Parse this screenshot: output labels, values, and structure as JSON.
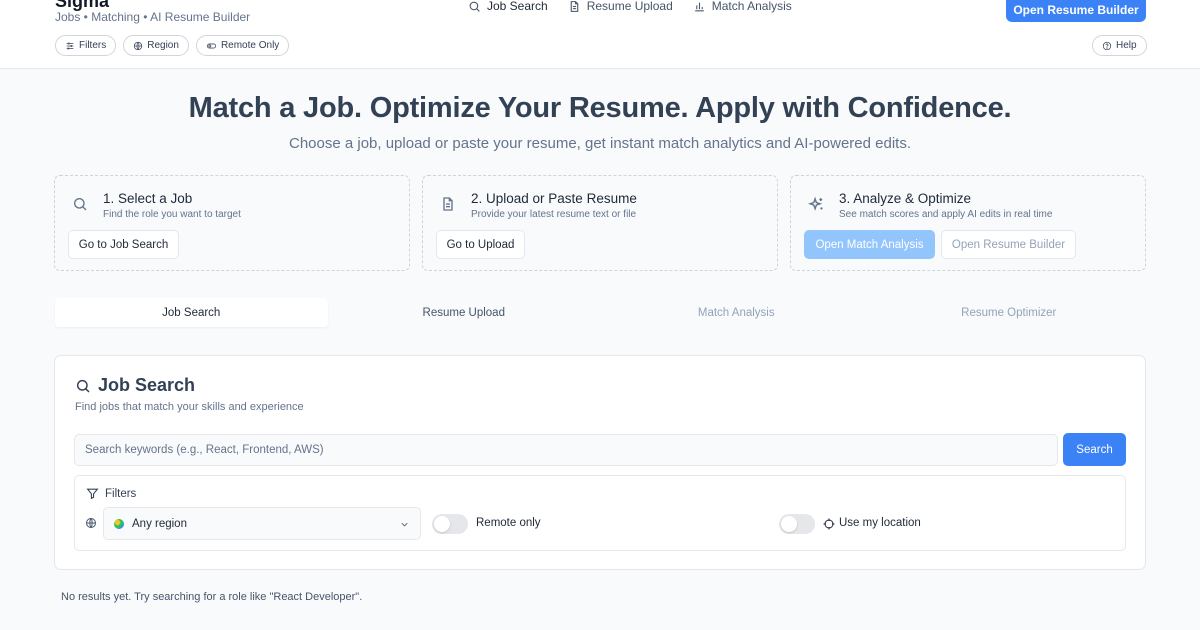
{
  "header": {
    "brand": "Sigma",
    "subtitle": "Jobs • Matching • AI Resume Builder",
    "nav": [
      {
        "label": "Job Search",
        "icon": "search-icon"
      },
      {
        "label": "Resume Upload",
        "icon": "file-icon"
      },
      {
        "label": "Match Analysis",
        "icon": "bar-chart-icon"
      }
    ],
    "cta_label": "Open Resume Builder",
    "chips": [
      {
        "label": "Filters",
        "icon": "sliders-icon"
      },
      {
        "label": "Region",
        "icon": "globe-icon"
      },
      {
        "label": "Remote Only",
        "icon": "toggle-icon"
      }
    ],
    "help_label": "Help"
  },
  "hero": {
    "title": "Match a Job. Optimize Your Resume. Apply with Confidence.",
    "subtitle": "Choose a job, upload or paste your resume, get instant match analytics and AI-powered edits."
  },
  "steps": [
    {
      "title": "1. Select a Job",
      "desc": "Find the role you want to target",
      "button": "Go to Job Search",
      "icon": "search-icon"
    },
    {
      "title": "2. Upload or Paste Resume",
      "desc": "Provide your latest resume text or file",
      "button": "Go to Upload",
      "icon": "file-icon"
    },
    {
      "title": "3. Analyze & Optimize",
      "desc": "See match scores and apply AI edits in real time",
      "button_primary": "Open Match Analysis",
      "button_secondary": "Open Resume Builder",
      "icon": "sparkles-icon"
    }
  ],
  "tabs": [
    "Job Search",
    "Resume Upload",
    "Match Analysis",
    "Resume Optimizer"
  ],
  "job_search": {
    "title": "Job Search",
    "subtitle": "Find jobs that match your skills and experience",
    "placeholder": "Search keywords (e.g., React, Frontend, AWS)",
    "search_button": "Search",
    "filters_label": "Filters",
    "region_value": "Any region",
    "remote_label": "Remote only",
    "location_label": "Use my location",
    "remote_on": false,
    "location_on": false
  },
  "empty_state": "No results yet. Try searching for a role like \"React Developer\".",
  "colors": {
    "accent": "#3b82f6",
    "accent_soft": "#93c5fd"
  }
}
